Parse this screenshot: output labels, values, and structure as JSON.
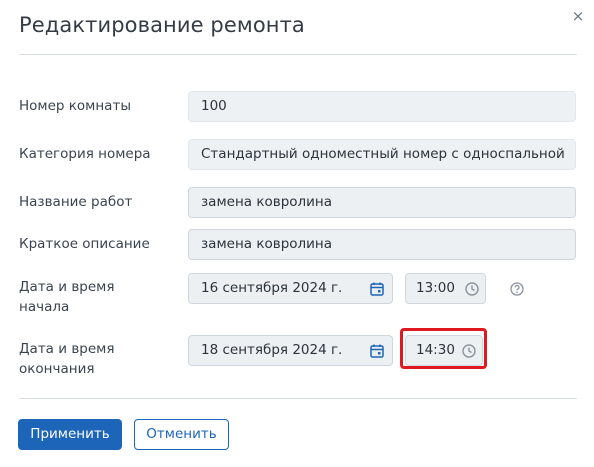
{
  "dialog": {
    "title": "Редактирование ремонта",
    "close_label": "×"
  },
  "form": {
    "room_number": {
      "label": "Номер комнаты",
      "value": "100"
    },
    "room_category": {
      "label": "Категория номера",
      "value": "Стандартный одноместный номер с односпальной"
    },
    "work_name": {
      "label": "Название работ",
      "value": "замена ковролина"
    },
    "short_description": {
      "label": "Краткое описание",
      "value": "замена ковролина"
    },
    "start": {
      "label_line1": "Дата и время",
      "label_line2": "начала",
      "date": "16 сентября 2024 г.",
      "time": "13:00"
    },
    "end": {
      "label_line1": "Дата и время",
      "label_line2": "окончания",
      "date": "18 сентября 2024 г.",
      "time": "14:30"
    }
  },
  "buttons": {
    "apply": "Применить",
    "cancel": "Отменить"
  },
  "icons": {
    "close": "close-icon",
    "calendar": "calendar-icon",
    "clock": "clock-icon",
    "help": "help-icon"
  },
  "colors": {
    "primary": "#1d65b8",
    "highlight": "#e0181f",
    "field_bg": "#edf0f3"
  }
}
